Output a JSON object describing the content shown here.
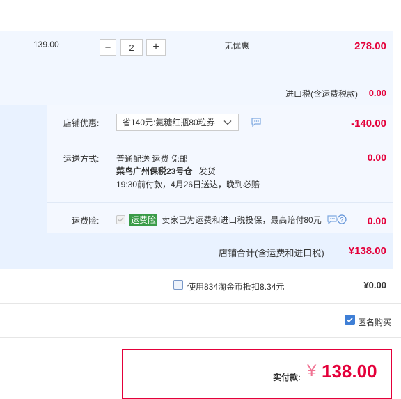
{
  "item": {
    "unit_price": "139.00",
    "quantity": "2",
    "minus_symbol": "−",
    "plus_symbol": "+",
    "discount": "无优惠",
    "subtotal": "278.00"
  },
  "import_tax": {
    "label": "进口税(含运费税款)",
    "value": "0.00"
  },
  "shop_discount": {
    "label": "店铺优惠:",
    "selected": "省140元:氨糖红瓶80粒券",
    "value": "-140.00"
  },
  "shipping": {
    "label": "运送方式:",
    "line1": "普通配送 运费 免邮",
    "line2_warehouse": "菜鸟广州保税23号仓",
    "line2_suffix": "发货",
    "line3": "19:30前付款，4月26日送达，晚到必赔",
    "value": "0.00"
  },
  "freight_insurance": {
    "label": "运费险:",
    "tag": "运费险",
    "text": "卖家已为运费和进口税投保，最高赔付80元",
    "value": "0.00"
  },
  "shop_total": {
    "label": "店铺合计(含运费和进口税)",
    "value": "¥138.00"
  },
  "coins": {
    "text": "使用834淘金币抵扣8.34元",
    "value": "¥0.00"
  },
  "anonymous": {
    "label": "匿名购买",
    "checked": true
  },
  "payment": {
    "label": "实付款:",
    "currency": "¥",
    "amount": "138.00"
  },
  "colors": {
    "accent_red": "#e4003a",
    "blue_check": "#3f7fd6",
    "tag_green": "#3a9b48"
  }
}
